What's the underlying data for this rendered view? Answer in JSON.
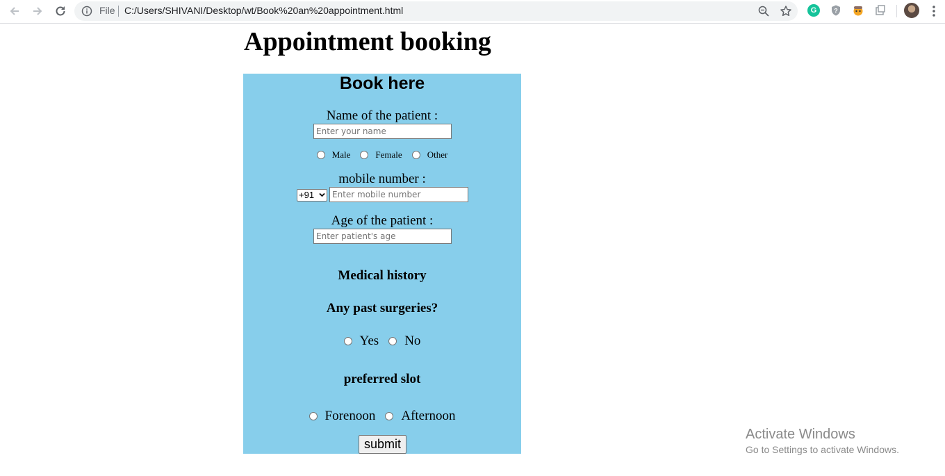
{
  "browser": {
    "file_label": "File",
    "url": "C:/Users/SHIVANI/Desktop/wt/Book%20an%20appointment.html",
    "extensions": [
      "grammarly-icon",
      "shield-extension-icon",
      "face-extension-icon",
      "puzzle-extension-icon"
    ],
    "accent_color": "#15c39a"
  },
  "page": {
    "title": "Appointment booking"
  },
  "form": {
    "background": "#87ceeb",
    "heading": "Book here",
    "name_label": "Name of the patient :",
    "name_placeholder": "Enter your name",
    "gender_options": [
      "Male",
      "Female",
      "Other"
    ],
    "mobile_label": "mobile number :",
    "country_code": "+91",
    "mobile_placeholder": "Enter mobile number",
    "age_label": "Age of the patient :",
    "age_placeholder": "Enter patient's age",
    "medical_history_heading": "Medical history",
    "surgeries_question": "Any past surgeries?",
    "surgery_options": [
      "Yes",
      "No"
    ],
    "slot_heading": "preferred slot",
    "slot_options": [
      "Forenoon",
      "Afternoon"
    ],
    "submit_label": "submit"
  },
  "watermark": {
    "title": "Activate Windows",
    "subtitle": "Go to Settings to activate Windows."
  }
}
